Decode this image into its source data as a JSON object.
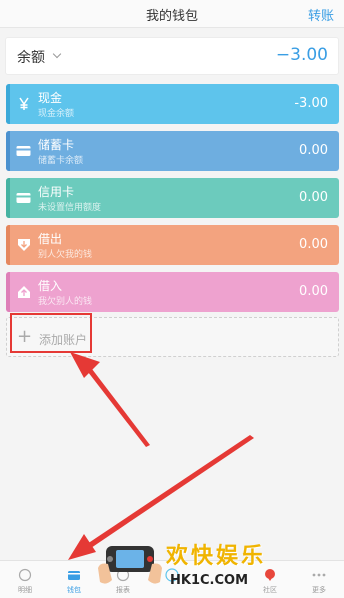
{
  "header": {
    "title": "我的钱包",
    "transfer_label": "转账"
  },
  "balance": {
    "label": "余额",
    "amount": "−3.00"
  },
  "accounts": [
    {
      "name": "现金",
      "sub": "现金余额",
      "value": "-3.00",
      "icon": "yen-icon"
    },
    {
      "name": "储蓄卡",
      "sub": "储蓄卡余额",
      "value": "0.00",
      "icon": "card-icon"
    },
    {
      "name": "信用卡",
      "sub": "未设置信用额度",
      "value": "0.00",
      "icon": "card-icon"
    },
    {
      "name": "借出",
      "sub": "别人欠我的钱",
      "value": "0.00",
      "icon": "lend-out-icon"
    },
    {
      "name": "借入",
      "sub": "我欠别人的钱",
      "value": "0.00",
      "icon": "borrow-in-icon"
    }
  ],
  "add_account": {
    "label": "添加账户"
  },
  "nav": {
    "items": [
      {
        "label": "明细"
      },
      {
        "label": "钱包"
      },
      {
        "label": "报表"
      },
      {
        "label": ""
      },
      {
        "label": ""
      },
      {
        "label": "社区"
      },
      {
        "label": "更多"
      }
    ]
  },
  "watermark": {
    "text": "欢快娱乐",
    "url": "HK1C.COM"
  },
  "colors": {
    "accent": "#3a9ee4",
    "cash": "#5ec4ec",
    "savings": "#6eaee0",
    "credit": "#6ccbbd",
    "lend": "#f3a37f",
    "borrow": "#eea2cf",
    "highlight": "#e53935"
  }
}
